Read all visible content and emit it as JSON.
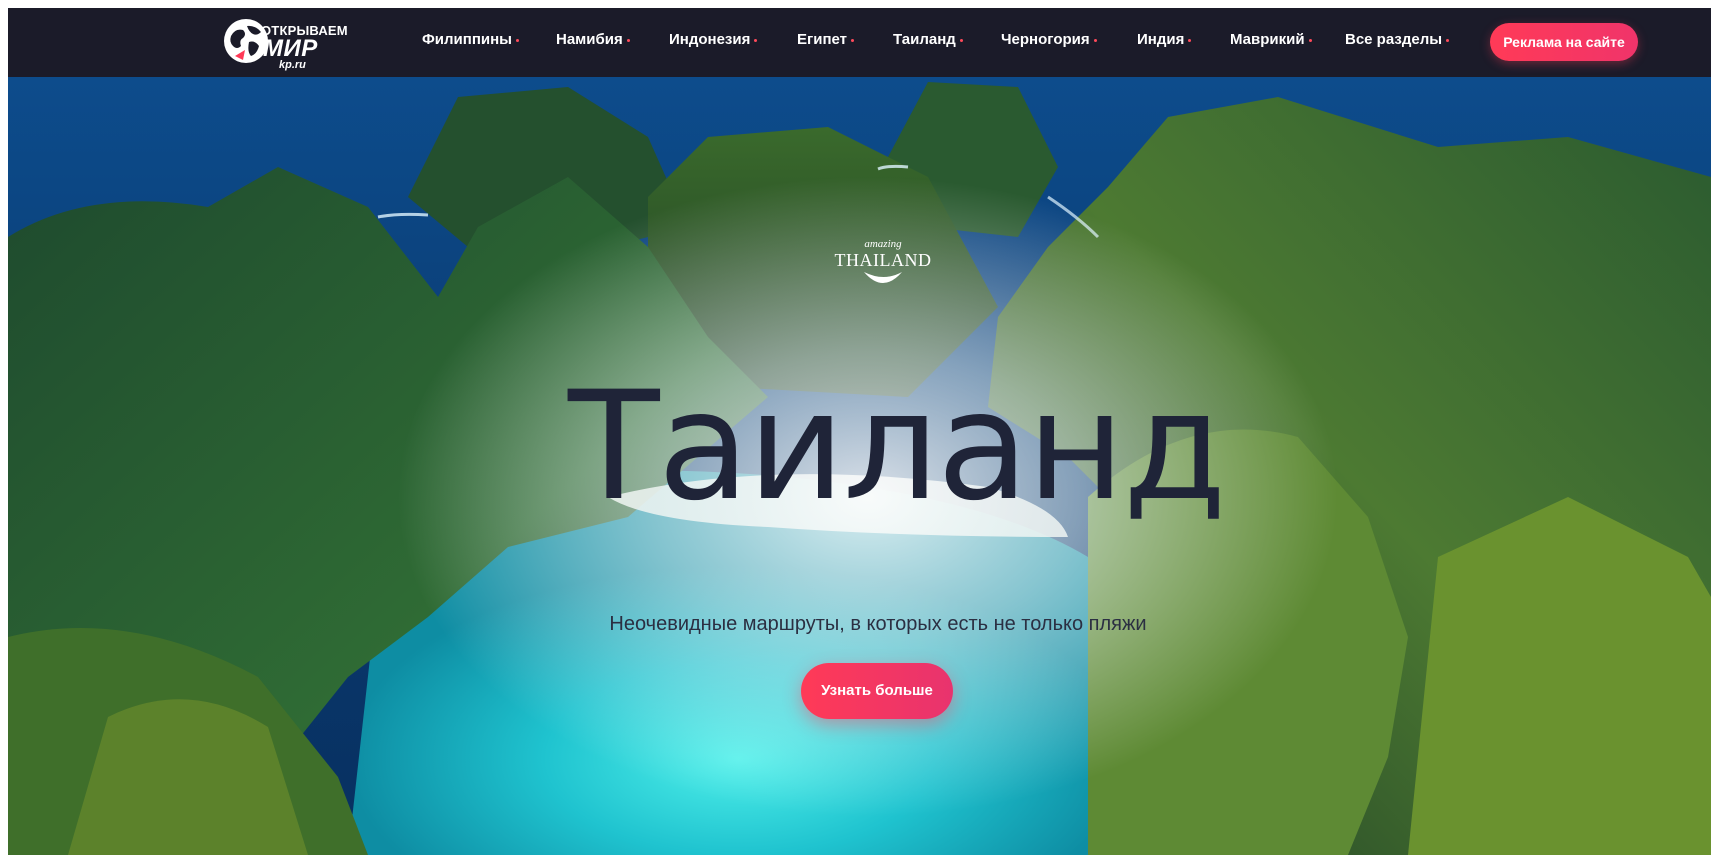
{
  "header": {
    "logo": {
      "line1": "ОТКРЫВАЕМ",
      "line2": "МИР",
      "line3": "kp.ru",
      "icon": "globe-icon"
    },
    "nav": [
      {
        "label": "Филиппины"
      },
      {
        "label": "Намибия"
      },
      {
        "label": "Индонезия"
      },
      {
        "label": "Египет"
      },
      {
        "label": "Таиланд"
      },
      {
        "label": "Черногория"
      },
      {
        "label": "Индия"
      },
      {
        "label": "Маврикий"
      },
      {
        "label": "Все разделы"
      }
    ],
    "ad_button": "Реклама на сайте"
  },
  "hero": {
    "badge": {
      "small": "amazing",
      "big": "THAILAND"
    },
    "title": "Таиланд",
    "subtitle": "Неочевидные маршруты, в которых есть не только пляжи",
    "cta": "Узнать больше"
  },
  "colors": {
    "header_bg": "#1b1b29",
    "accent": "#ff3a57",
    "title": "#1f2438"
  }
}
